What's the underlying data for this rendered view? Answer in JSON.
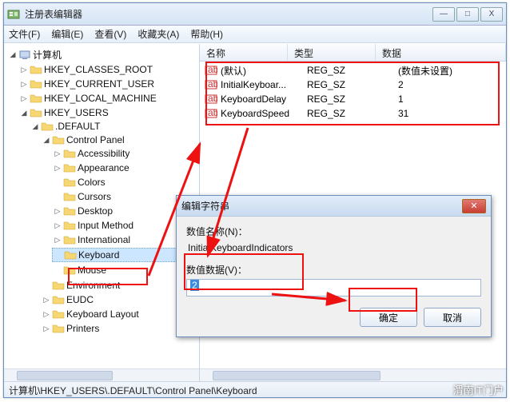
{
  "window": {
    "title": "注册表编辑器",
    "buttons": {
      "min": "—",
      "max": "□",
      "close": "X"
    }
  },
  "menu": {
    "file": "文件(F)",
    "edit": "编辑(E)",
    "view": "查看(V)",
    "fav": "收藏夹(A)",
    "help": "帮助(H)"
  },
  "tree": {
    "root": "计算机",
    "hkcr": "HKEY_CLASSES_ROOT",
    "hkcu": "HKEY_CURRENT_USER",
    "hklm": "HKEY_LOCAL_MACHINE",
    "hku": "HKEY_USERS",
    "default": ".DEFAULT",
    "cp": "Control Panel",
    "cp_items": {
      "accessibility": "Accessibility",
      "appearance": "Appearance",
      "colors": "Colors",
      "cursors": "Cursors",
      "desktop": "Desktop",
      "inputmethod": "Input Method",
      "international": "International",
      "keyboard": "Keyboard",
      "mouse": "Mouse"
    },
    "others": {
      "environment": "Environment",
      "eudc": "EUDC",
      "keyboardlayout": "Keyboard Layout",
      "printers": "Printers"
    }
  },
  "list": {
    "headers": {
      "name": "名称",
      "type": "类型",
      "data": "数据"
    },
    "rows": [
      {
        "name": "(默认)",
        "type": "REG_SZ",
        "data": "(数值未设置)"
      },
      {
        "name": "InitialKeyboar...",
        "type": "REG_SZ",
        "data": "2"
      },
      {
        "name": "KeyboardDelay",
        "type": "REG_SZ",
        "data": "1"
      },
      {
        "name": "KeyboardSpeed",
        "type": "REG_SZ",
        "data": "31"
      }
    ]
  },
  "dialog": {
    "title": "编辑字符串",
    "name_label": "数值名称(N)：",
    "name_value": "InitialKeyboardIndicators",
    "data_label": "数值数据(V)：",
    "data_value": "2",
    "ok": "确定",
    "cancel": "取消"
  },
  "status": {
    "path": "计算机\\HKEY_USERS\\.DEFAULT\\Control Panel\\Keyboard"
  },
  "watermark": "渭南IT门户"
}
